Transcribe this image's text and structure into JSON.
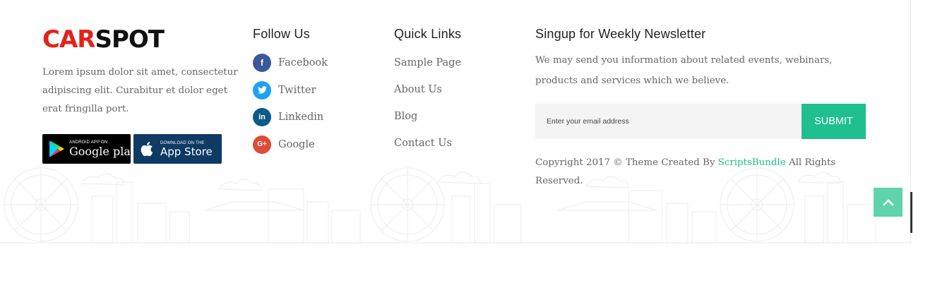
{
  "brand": {
    "logo_part1": "CAR",
    "logo_part2": "SPOT",
    "accent_color": "#e2231a"
  },
  "about": {
    "text": "Lorem ipsum dolor sit amet, consectetur adipiscing elit. Curabitur et dolor eget erat fringilla port."
  },
  "app_badges": {
    "google_small": "ANDROID APP ON",
    "google_big": "Google play",
    "apple_small": "Download on the",
    "apple_big": "App Store"
  },
  "follow": {
    "title": "Follow Us",
    "items": [
      {
        "label": "Facebook",
        "icon": "facebook-icon",
        "glyph": "f",
        "color": "#3b5998"
      },
      {
        "label": "Twitter",
        "icon": "twitter-icon",
        "glyph": "t",
        "color": "#1da1f2"
      },
      {
        "label": "Linkedin",
        "icon": "linkedin-icon",
        "glyph": "in",
        "color": "#0e5a86"
      },
      {
        "label": "Google",
        "icon": "google-plus-icon",
        "glyph": "G+",
        "color": "#dd4b39"
      }
    ]
  },
  "quick_links": {
    "title": "Quick Links",
    "items": [
      "Sample Page",
      "About Us",
      "Blog",
      "Contact Us"
    ]
  },
  "newsletter": {
    "title": "Singup for Weekly Newsletter",
    "text": "We may send you information about related events, webinars, products and services which we believe.",
    "email_placeholder": "Enter your email address",
    "submit_label": "SUBMIT",
    "button_color": "#1fbf8f"
  },
  "copyright": {
    "before": "Copyright 2017 © Theme Created By ",
    "link": "ScriptsBundle",
    "after": " All Rights Reserved."
  },
  "back_to_top": {
    "icon": "chevron-up-icon",
    "color": "#5fd3ab"
  }
}
